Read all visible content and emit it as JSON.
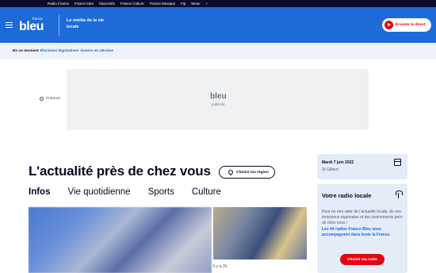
{
  "topbar": {
    "links": [
      "Radio France",
      "France Inter",
      "franceinfo",
      "France Culture",
      "France Musique",
      "Fip",
      "Mouv",
      "+"
    ]
  },
  "header": {
    "logo_small": "france",
    "logo_main": "bleu",
    "tagline": "Le média de la vie locale",
    "listen_label": "Écouter le direct"
  },
  "trending": {
    "lead": "En ce moment",
    "tags": [
      "Élections législatives",
      "Guerre en Ukraine"
    ]
  },
  "ad": {
    "label": "Publicité",
    "logo": "bleu",
    "sub": "publicité"
  },
  "main": {
    "headline": "L'actualité près de chez vous",
    "region_button": "Choisir ma région",
    "tabs": [
      "Infos",
      "Vie quotidienne",
      "Sports",
      "Culture"
    ],
    "side_article_time": "Il y a 2h"
  },
  "sidebar": {
    "date": "Mardi 7 juin 2022",
    "city": "St Gilbert",
    "radio_title": "Votre radio locale",
    "radio_desc": "Pour ne rien rater de l'actualité locale, de vos émissions régionales et des événements près de chez vous !",
    "radio_highlight": "Les 44 radios France Bleu vous accompagnent dans toute la France.",
    "radio_cta": "Choisir ma radio"
  },
  "colors": {
    "brand_blue": "#1e6ad8",
    "accent_red": "#e30613",
    "dark": "#0b0b2b"
  }
}
